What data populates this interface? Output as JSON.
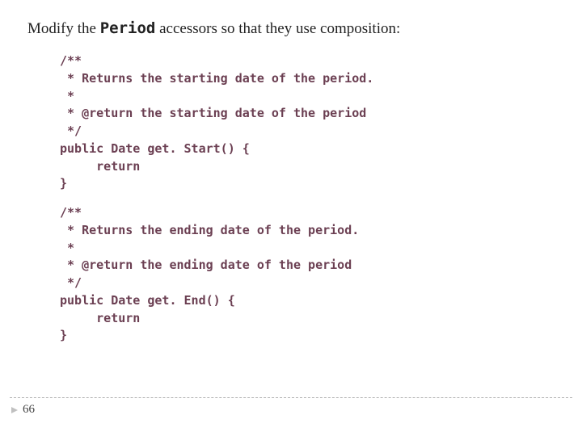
{
  "title": {
    "before": "Modify the ",
    "mono": "Period",
    "after": " accessors so that they use composition:"
  },
  "code1": "/**\n * Returns the starting date of the period.\n *\n * @return the starting date of the period\n */\npublic Date get. Start() {\n     return\n}",
  "code2": "/**\n * Returns the ending date of the period.\n *\n * @return the ending date of the period\n */\npublic Date get. End() {\n     return\n}",
  "page_number": "66"
}
